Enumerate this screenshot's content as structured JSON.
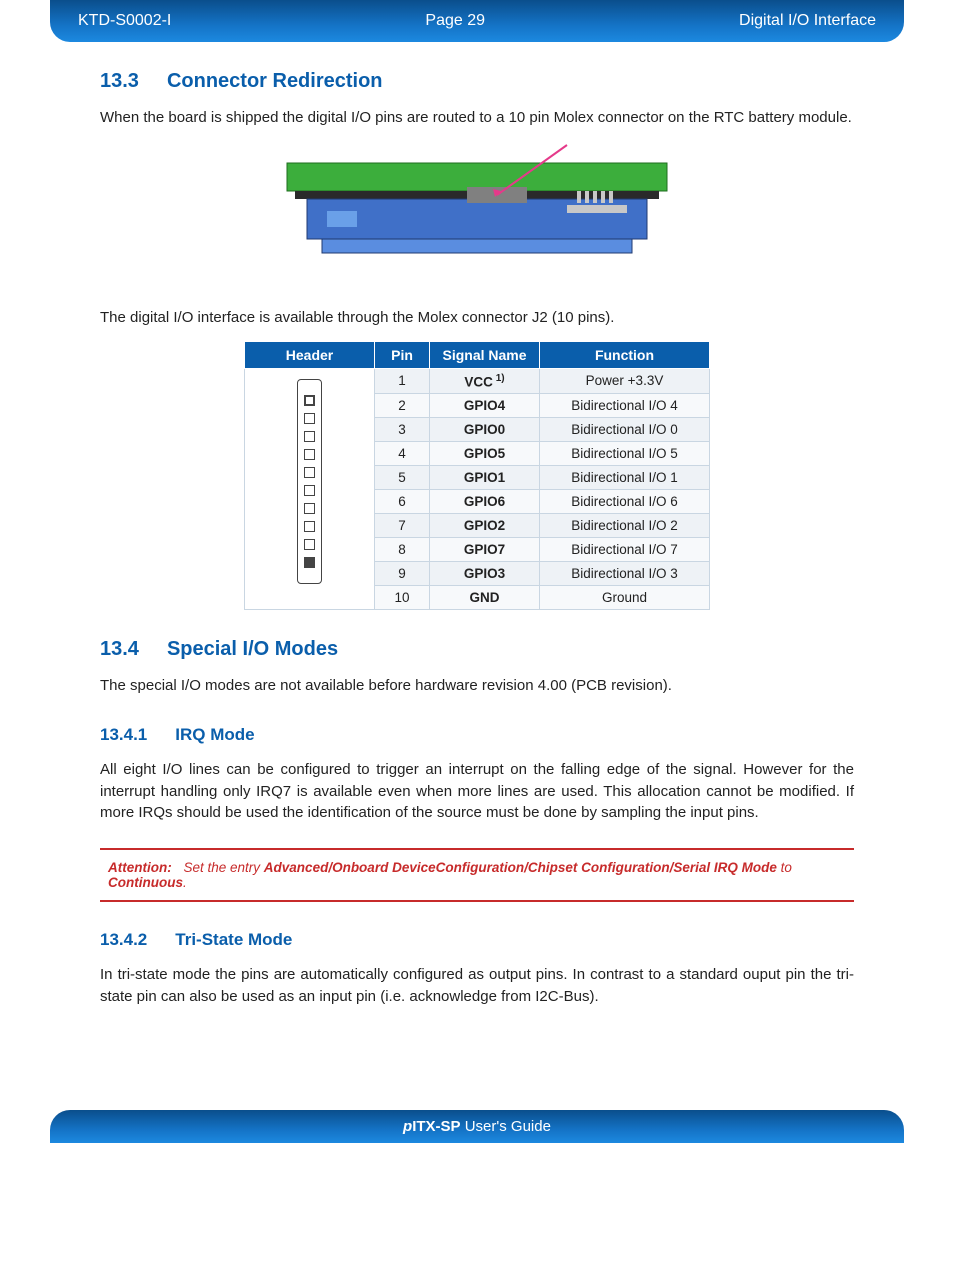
{
  "header": {
    "doc_id": "KTD-S0002-I",
    "page": "Page 29",
    "section": "Digital I/O Interface"
  },
  "sec_13_3": {
    "num": "13.3",
    "title": "Connector Redirection",
    "para1": "When the board is shipped the digital I/O pins are routed to a 10 pin Molex connector on the RTC battery module.",
    "para2": "The digital I/O interface is available through the Molex connector J2 (10 pins)."
  },
  "pin_table": {
    "headers": {
      "c0": "Header",
      "c1": "Pin",
      "c2": "Signal Name",
      "c3": "Function"
    },
    "rows": [
      {
        "pin": "1",
        "signal": "VCC",
        "fnote": "1)",
        "function": "Power +3.3V"
      },
      {
        "pin": "2",
        "signal": "GPIO4",
        "fnote": "",
        "function": "Bidirectional I/O  4"
      },
      {
        "pin": "3",
        "signal": "GPIO0",
        "fnote": "",
        "function": "Bidirectional I/O  0"
      },
      {
        "pin": "4",
        "signal": "GPIO5",
        "fnote": "",
        "function": "Bidirectional I/O  5"
      },
      {
        "pin": "5",
        "signal": "GPIO1",
        "fnote": "",
        "function": "Bidirectional I/O  1"
      },
      {
        "pin": "6",
        "signal": "GPIO6",
        "fnote": "",
        "function": "Bidirectional I/O  6"
      },
      {
        "pin": "7",
        "signal": "GPIO2",
        "fnote": "",
        "function": "Bidirectional I/O  2"
      },
      {
        "pin": "8",
        "signal": "GPIO7",
        "fnote": "",
        "function": "Bidirectional I/O  7"
      },
      {
        "pin": "9",
        "signal": "GPIO3",
        "fnote": "",
        "function": "Bidirectional I/O  3"
      },
      {
        "pin": "10",
        "signal": "GND",
        "fnote": "",
        "function": "Ground"
      }
    ]
  },
  "sec_13_4": {
    "num": "13.4",
    "title": "Special I/O Modes",
    "para1": "The special I/O modes are not available before hardware revision 4.00 (PCB revision)."
  },
  "sec_13_4_1": {
    "num": "13.4.1",
    "title": "IRQ Mode",
    "para1": "All eight I/O lines can be configured to trigger an interrupt on the falling edge of the signal. However for the interrupt handling only IRQ7 is available even when more lines are used. This allocation cannot be modified. If more IRQs should be used the identification of the source must be done by sampling the input pins."
  },
  "attention": {
    "label": "Attention:",
    "pre": "Set the entry ",
    "path": "Advanced/Onboard DeviceConfiguration/Chipset Configuration/Serial IRQ Mode",
    "mid": " to ",
    "value": "Continuous",
    "post": "."
  },
  "sec_13_4_2": {
    "num": "13.4.2",
    "title": "Tri-State Mode",
    "para1": "In tri-state mode the pins are automatically configured as output pins. In contrast to a standard ouput pin the tri-state pin can also be used as an input pin (i.e. acknowledge from I2C-Bus)."
  },
  "footer": {
    "prefix": "p",
    "bold": "ITX-SP",
    "rest": " User's Guide"
  }
}
